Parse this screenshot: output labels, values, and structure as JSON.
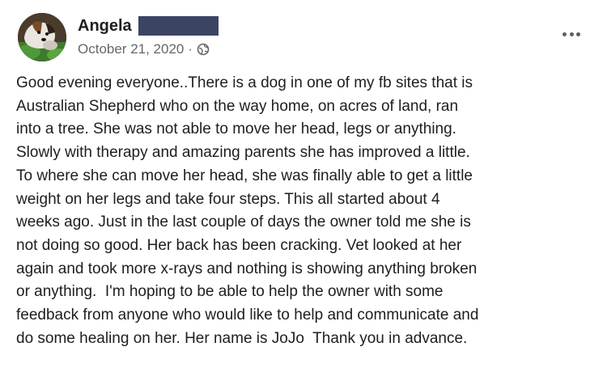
{
  "post": {
    "author": {
      "name": "Angela",
      "name_redacted": true
    },
    "meta": {
      "date": "October 21, 2020",
      "separator": "·",
      "audience_icon": "globe-icon"
    },
    "more_menu_icon": "ellipsis-icon",
    "body_lines": [
      "Good evening everyone..There is a dog in one of my fb sites that is",
      "Australian Shepherd who on the way home, on acres of land, ran",
      "into a tree. She was not able to move her head, legs or anything.",
      "Slowly with therapy and amazing parents she has improved a little.",
      "To where she can move her head, she was finally able to get a little",
      "weight on her legs and take four steps. This all started about 4",
      "weeks ago. Just in the last couple of days the owner told me she is",
      "not doing so good. Her back has been cracking. Vet looked at her",
      "again and took more x-rays and nothing is showing anything broken",
      "or anything.  I'm hoping to be able to help the owner with some",
      "feedback from anyone who would like to help and communicate and",
      "do some healing on her. Her name is JoJo  Thank you in advance."
    ]
  },
  "colors": {
    "text_primary": "#1c1e21",
    "text_secondary": "#65676b",
    "redaction_bar": "#3b4462",
    "background": "#ffffff"
  }
}
